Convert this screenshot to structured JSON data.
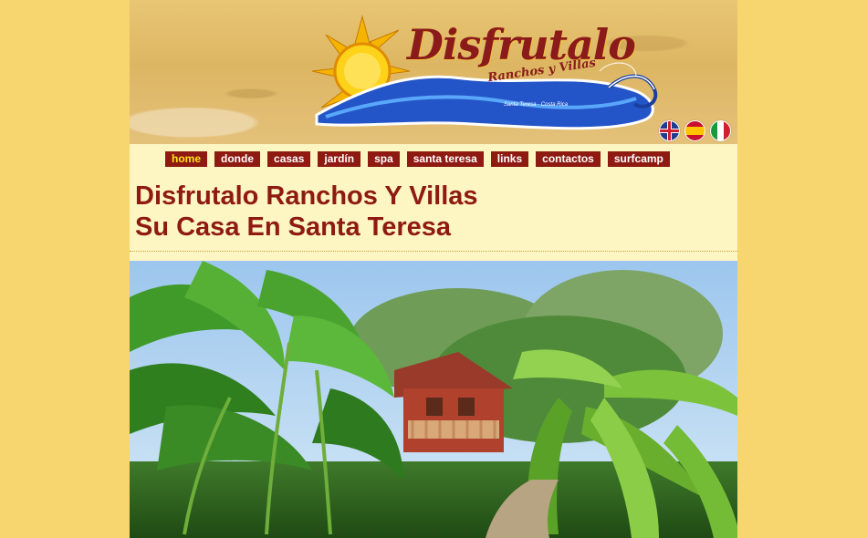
{
  "header": {
    "logo_title": "Disfrutalo",
    "logo_subtitle": "Ranchos y Villas",
    "logo_location": "Santa Teresa · Costa Rica"
  },
  "languages": [
    {
      "name": "english-flag-icon"
    },
    {
      "name": "spanish-flag-icon"
    },
    {
      "name": "italian-flag-icon"
    }
  ],
  "nav": {
    "items": [
      {
        "label": "home",
        "active": true
      },
      {
        "label": "donde"
      },
      {
        "label": "casas"
      },
      {
        "label": "jardín"
      },
      {
        "label": "spa"
      },
      {
        "label": "santa teresa"
      },
      {
        "label": "links"
      },
      {
        "label": "contactos"
      },
      {
        "label": "surfcamp"
      }
    ]
  },
  "main": {
    "title_line1": "Disfrutalo Ranchos Y Villas",
    "title_line2": "Su Casa En Santa Teresa"
  },
  "colors": {
    "background": "#f7d66f",
    "content_bg": "#fdf6c2",
    "nav_button": "#8e1a12",
    "nav_active_text": "#ffe31a",
    "title": "#8e1a12"
  }
}
